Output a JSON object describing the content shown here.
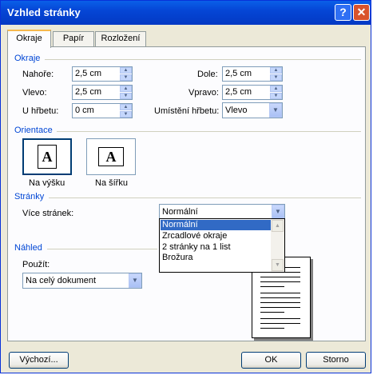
{
  "window": {
    "title": "Vzhled stránky",
    "help": "?",
    "close": "✕"
  },
  "tabs": [
    "Okraje",
    "Papír",
    "Rozložení"
  ],
  "margins": {
    "group": "Okraje",
    "top_label": "Nahoře:",
    "top_value": "2,5 cm",
    "bottom_label": "Dole:",
    "bottom_value": "2,5 cm",
    "left_label": "Vlevo:",
    "left_value": "2,5 cm",
    "right_label": "Vpravo:",
    "right_value": "2,5 cm",
    "gutter_label": "U hřbetu:",
    "gutter_value": "0 cm",
    "gutter_pos_label": "Umístění hřbetu:",
    "gutter_pos_value": "Vlevo"
  },
  "orientation": {
    "group": "Orientace",
    "portrait": "Na výšku",
    "landscape": "Na šířku",
    "selected": "portrait",
    "glyph": "A"
  },
  "pages": {
    "group": "Stránky",
    "multiple_label": "Více stránek:",
    "multiple_value": "Normální",
    "options": [
      "Normální",
      "Zrcadlové okraje",
      "2 stránky na 1 list",
      "Brožura"
    ]
  },
  "preview": {
    "group": "Náhled",
    "apply_label": "Použít:",
    "apply_value": "Na celý dokument"
  },
  "buttons": {
    "default": "Výchozí...",
    "ok": "OK",
    "cancel": "Storno"
  }
}
